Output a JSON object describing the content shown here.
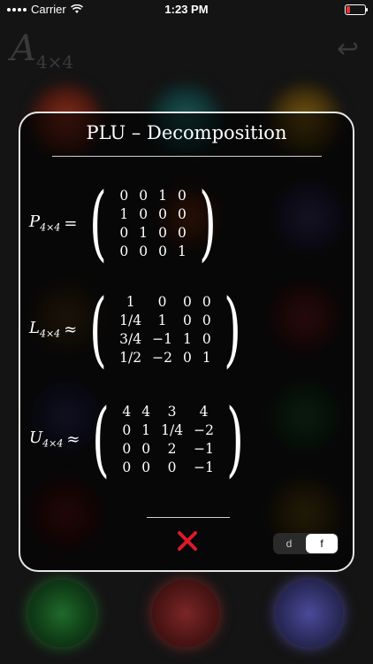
{
  "status": {
    "carrier": "Carrier",
    "time": "1:23 PM",
    "battery_color": "#e53535"
  },
  "background": {
    "title": "A",
    "title_sub": "4×4",
    "undo_icon": "undo-arrow-icon"
  },
  "modal": {
    "title": "PLU – Decomposition",
    "matrices": [
      {
        "symbol": "P",
        "sub": "4×4",
        "relation": "=",
        "rows": [
          [
            "0",
            "0",
            "1",
            "0"
          ],
          [
            "1",
            "0",
            "0",
            "0"
          ],
          [
            "0",
            "1",
            "0",
            "0"
          ],
          [
            "0",
            "0",
            "0",
            "1"
          ]
        ]
      },
      {
        "symbol": "L",
        "sub": "4×4",
        "relation": "≈",
        "rows": [
          [
            "1",
            "0",
            "0",
            "0"
          ],
          [
            "1/4",
            "1",
            "0",
            "0"
          ],
          [
            "3/4",
            "−1",
            "1",
            "0"
          ],
          [
            "1/2",
            "−2",
            "0",
            "1"
          ]
        ]
      },
      {
        "symbol": "U",
        "sub": "4×4",
        "relation": "≈",
        "rows": [
          [
            "4",
            "4",
            "3",
            "4"
          ],
          [
            "0",
            "1",
            "1/4",
            "−2"
          ],
          [
            "0",
            "0",
            "2",
            "−1"
          ],
          [
            "0",
            "0",
            "0",
            "−1"
          ]
        ]
      }
    ],
    "close_icon": "close-x-icon",
    "close_color": "#e0182a",
    "toggle": {
      "options": [
        "d",
        "f"
      ],
      "selected": "f"
    }
  }
}
